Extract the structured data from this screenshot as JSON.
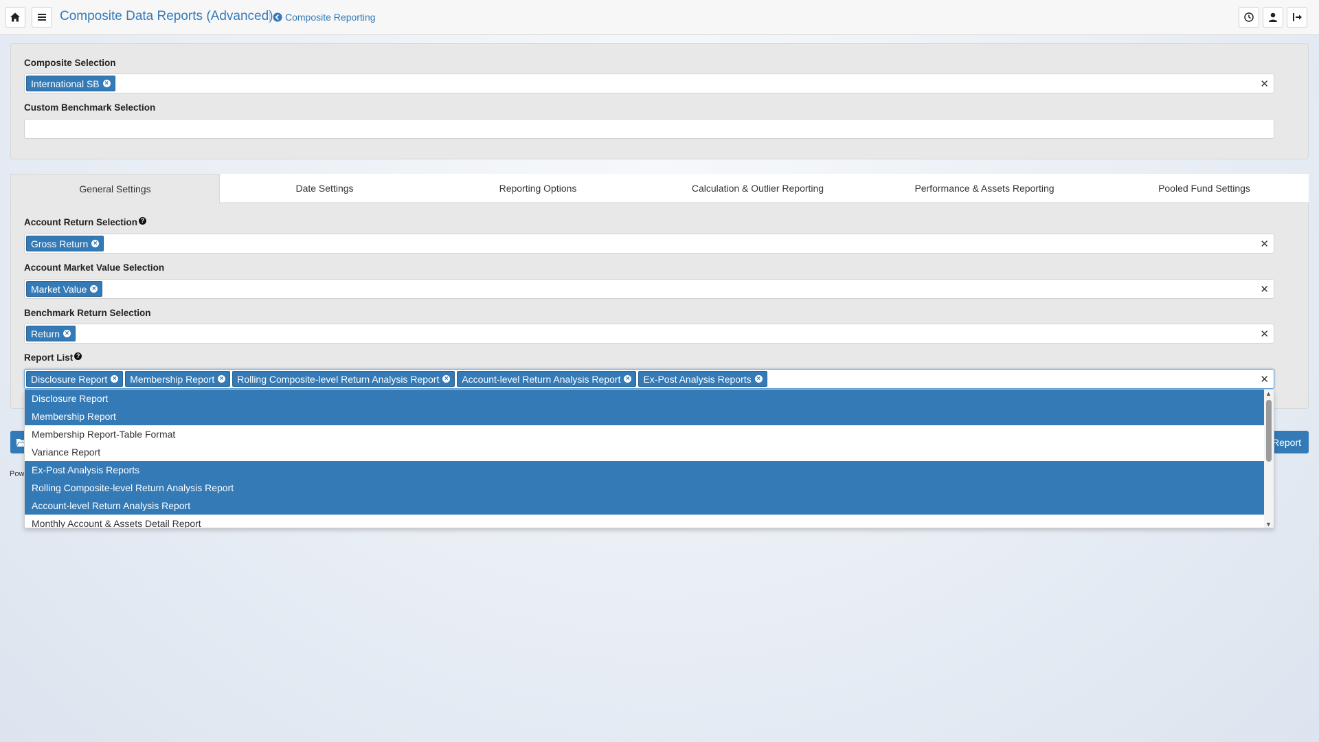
{
  "header": {
    "title": "Composite Data Reports (Advanced)",
    "breadcrumb": "Composite Reporting"
  },
  "selection": {
    "composite_label": "Composite Selection",
    "composite_tags": [
      "International SB"
    ],
    "benchmark_label": "Custom Benchmark Selection"
  },
  "tabs": [
    "General Settings",
    "Date Settings",
    "Reporting Options",
    "Calculation & Outlier Reporting",
    "Performance & Assets Reporting",
    "Pooled Fund Settings"
  ],
  "general": {
    "account_return_label": "Account Return Selection",
    "account_return_tags": [
      "Gross Return"
    ],
    "market_value_label": "Account Market Value Selection",
    "market_value_tags": [
      "Market Value"
    ],
    "benchmark_return_label": "Benchmark Return Selection",
    "benchmark_return_tags": [
      "Return"
    ],
    "report_list_label": "Report List",
    "report_list_tags": [
      "Disclosure Report",
      "Membership Report",
      "Rolling Composite-level Return Analysis Report",
      "Account-level Return Analysis Report",
      "Ex-Post Analysis Reports"
    ]
  },
  "dropdown": {
    "options": [
      {
        "label": "Disclosure Report",
        "selected": true
      },
      {
        "label": "Membership Report",
        "selected": true
      },
      {
        "label": "Membership Report-Table Format",
        "selected": false
      },
      {
        "label": "Variance Report",
        "selected": false
      },
      {
        "label": "Ex-Post Analysis Reports",
        "selected": true
      },
      {
        "label": "Rolling Composite-level Return Analysis Report",
        "selected": true
      },
      {
        "label": "Account-level Return Analysis Report",
        "selected": true
      },
      {
        "label": "Monthly Account & Assets Detail Report",
        "selected": false
      }
    ]
  },
  "actions": {
    "run_label": "Report",
    "footer_text": "Pow"
  },
  "symbols": {
    "clear": "✕",
    "tag_remove": "×",
    "help": "?"
  },
  "colors": {
    "accent": "#337ab7"
  }
}
